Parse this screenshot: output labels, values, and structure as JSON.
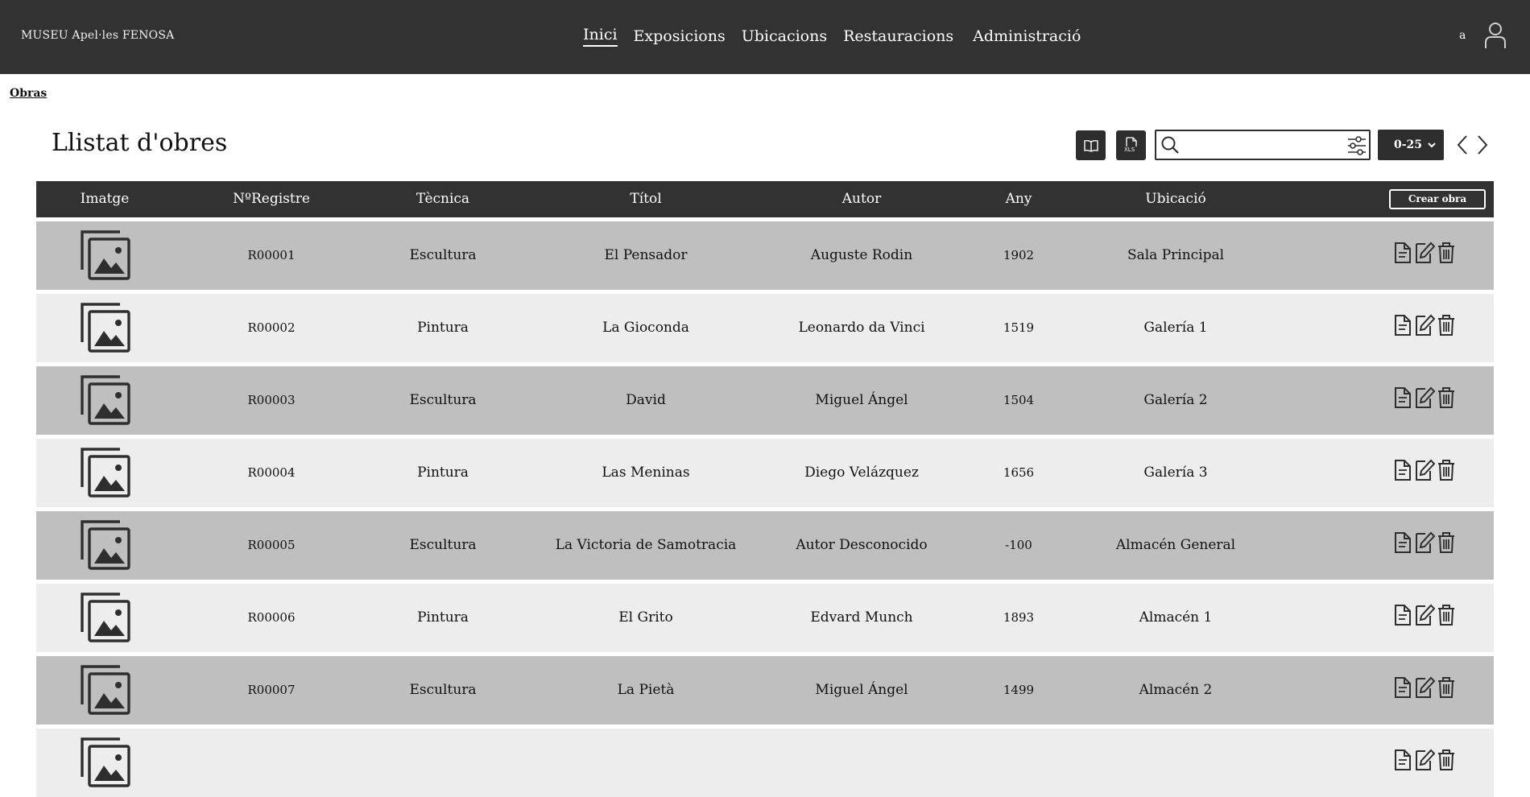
{
  "header": {
    "brand": "MUSEU Apel·les FENOSA",
    "nav": [
      {
        "label": "Inici",
        "active": true
      },
      {
        "label": "Exposicions",
        "active": false
      },
      {
        "label": "Ubicacions",
        "active": false
      },
      {
        "label": "Restauracions",
        "active": false
      },
      {
        "label": "Administració",
        "active": false
      }
    ],
    "user_initial": "a",
    "user_icon": "user-icon"
  },
  "breadcrumb": "Obras",
  "page_title": "Llistat d'obres",
  "toolbar": {
    "book_icon": "book-icon",
    "xls_icon": "xls-export-icon",
    "xls_label": "XLS",
    "search_placeholder": "",
    "search_value": "",
    "range": "0-25"
  },
  "table": {
    "headers": [
      "Imatge",
      "NºRegistre",
      "Tècnica",
      "Títol",
      "Autor",
      "Any",
      "Ubicació"
    ],
    "create_label": "Crear obra",
    "rows": [
      {
        "registre": "R00001",
        "tecnica": "Escultura",
        "titol": "El Pensador",
        "autor": "Auguste Rodin",
        "any": "1902",
        "ubicacio": "Sala Principal"
      },
      {
        "registre": "R00002",
        "tecnica": "Pintura",
        "titol": "La Gioconda",
        "autor": "Leonardo da Vinci",
        "any": "1519",
        "ubicacio": "Galería 1"
      },
      {
        "registre": "R00003",
        "tecnica": "Escultura",
        "titol": "David",
        "autor": "Miguel Ángel",
        "any": "1504",
        "ubicacio": "Galería 2"
      },
      {
        "registre": "R00004",
        "tecnica": "Pintura",
        "titol": "Las Meninas",
        "autor": "Diego Velázquez",
        "any": "1656",
        "ubicacio": "Galería 3"
      },
      {
        "registre": "R00005",
        "tecnica": "Escultura",
        "titol": "La Victoria de Samotracia",
        "autor": "Autor Desconocido",
        "any": "-100",
        "ubicacio": "Almacén General"
      },
      {
        "registre": "R00006",
        "tecnica": "Pintura",
        "titol": "El Grito",
        "autor": "Edvard Munch",
        "any": "1893",
        "ubicacio": "Almacén 1"
      },
      {
        "registre": "R00007",
        "tecnica": "Escultura",
        "titol": "La Pietà",
        "autor": "Miguel Ángel",
        "any": "1499",
        "ubicacio": "Almacén 2"
      },
      {
        "registre": "",
        "tecnica": "",
        "titol": "",
        "autor": "",
        "any": "",
        "ubicacio": ""
      }
    ]
  },
  "colors": {
    "header_bg": "#323232",
    "row_dark": "#bfbfbf",
    "row_light": "#ededed"
  }
}
